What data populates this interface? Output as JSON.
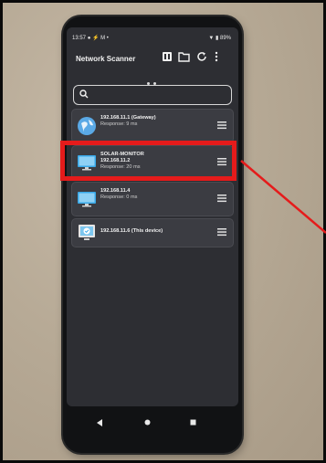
{
  "status_bar": {
    "time": "13:57",
    "indicators": "● ⚡ M •",
    "battery": "▼ ▮ 89%"
  },
  "app_bar": {
    "title": "Network Scanner",
    "actions": [
      "device-info-icon",
      "folder-icon",
      "refresh-icon",
      "more-vert-icon"
    ]
  },
  "search": {
    "icon": "search-icon",
    "value": ""
  },
  "devices": [
    {
      "name": "192.168.11.1 (Gateway)",
      "response": "Response: 9 ms",
      "icon": "globe-icon"
    },
    {
      "name": "SOLAR-MONITOR",
      "ip": "192.168.11.2",
      "response": "Response: 20 ms",
      "icon": "monitor-icon"
    },
    {
      "name": "192.168.11.4",
      "response": "Response: 0 ms",
      "icon": "monitor-icon"
    },
    {
      "name": "192.168.11.6 (This device)",
      "response": "",
      "icon": "this-device-icon"
    }
  ],
  "nav": [
    "back-icon",
    "home-icon",
    "recents-icon"
  ],
  "annotation": {
    "color": "#e51b1b"
  }
}
